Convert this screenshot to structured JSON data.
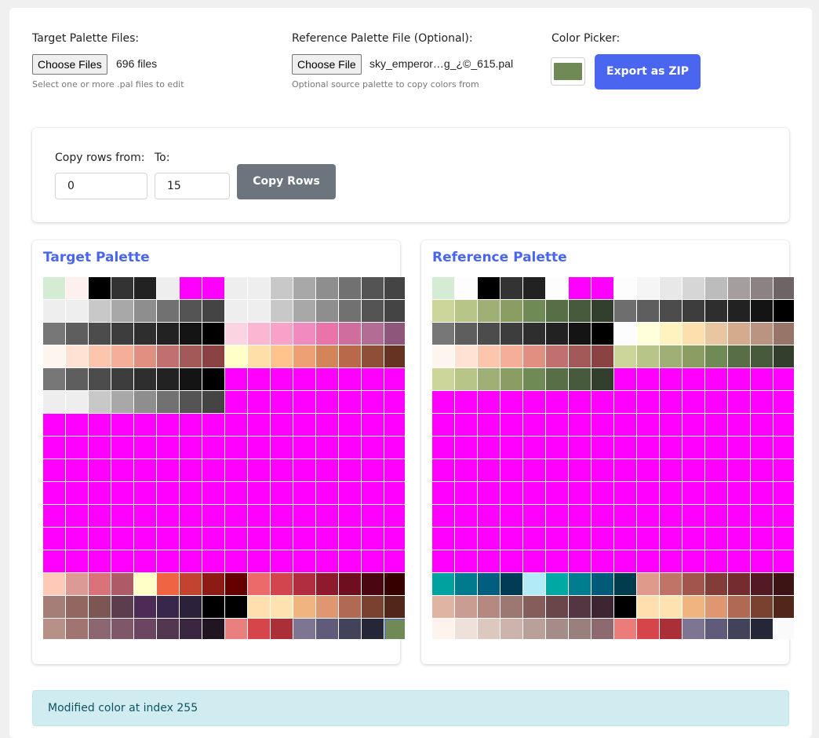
{
  "target_files": {
    "label": "Target Palette Files:",
    "button": "Choose Files",
    "file_status": "696 files",
    "help": "Select one or more .pal files to edit"
  },
  "reference_file": {
    "label": "Reference Palette File (Optional):",
    "button": "Choose File",
    "file_status": "sky_emperor…g_¿©_615.pal",
    "help": "Optional source palette to copy colors from"
  },
  "color_picker": {
    "label": "Color Picker:",
    "color": "#6f8a55"
  },
  "export_button": "Export as ZIP",
  "copy_rows": {
    "from_label": "Copy rows from:",
    "to_label": "To:",
    "from_value": "0",
    "to_value": "15",
    "button": "Copy Rows"
  },
  "target_palette": {
    "title": "Target Palette",
    "selected_index": 255,
    "rows": [
      [
        "#d4ecd3",
        "#fff0f0",
        "#000000",
        "#333333",
        "#222222",
        "#eeeeee",
        "#ff00ff",
        "#ff00ff",
        "#eeeeee",
        "#eeeeee",
        "#c8c8c8",
        "#a8a8a8",
        "#8e8e8e",
        "#717171",
        "#545454",
        "#444444"
      ],
      [
        "#eeeeee",
        "#eeeeee",
        "#c8c8c8",
        "#a8a8a8",
        "#8e8e8e",
        "#717171",
        "#545454",
        "#444444",
        "#eeeeee",
        "#eeeeee",
        "#c8c8c8",
        "#a8a8a8",
        "#8e8e8e",
        "#717171",
        "#545454",
        "#444444"
      ],
      [
        "#777777",
        "#5e5e5e",
        "#4c4c4c",
        "#3d3d3d",
        "#2e2e2e",
        "#222222",
        "#141414",
        "#000000",
        "#fcd3e1",
        "#fbb7d2",
        "#f8a2c8",
        "#f18bbf",
        "#ea73aa",
        "#d06d9f",
        "#b36c94",
        "#8e567a"
      ],
      [
        "#fff5ef",
        "#ffe2d4",
        "#fdc5ae",
        "#f5ae98",
        "#e18f81",
        "#c17070",
        "#a45959",
        "#8a4242",
        "#ffffc8",
        "#ffdfa8",
        "#ffc48d",
        "#eda073",
        "#d48459",
        "#b8694a",
        "#8f4e36",
        "#663222"
      ],
      [
        "#777777",
        "#5e5e5e",
        "#4c4c4c",
        "#3d3d3d",
        "#2e2e2e",
        "#222222",
        "#141414",
        "#000000",
        "#ff00ff",
        "#ff00ff",
        "#ff00ff",
        "#ff00ff",
        "#ff00ff",
        "#ff00ff",
        "#ff00ff",
        "#ff00ff"
      ],
      [
        "#eeeeee",
        "#eeeeee",
        "#c8c8c8",
        "#a8a8a8",
        "#8e8e8e",
        "#717171",
        "#545454",
        "#444444",
        "#ff00ff",
        "#ff00ff",
        "#ff00ff",
        "#ff00ff",
        "#ff00ff",
        "#ff00ff",
        "#ff00ff",
        "#ff00ff"
      ],
      [
        "#ff00ff",
        "#ff00ff",
        "#ff00ff",
        "#ff00ff",
        "#ff00ff",
        "#ff00ff",
        "#ff00ff",
        "#ff00ff",
        "#ff00ff",
        "#ff00ff",
        "#ff00ff",
        "#ff00ff",
        "#ff00ff",
        "#ff00ff",
        "#ff00ff",
        "#ff00ff"
      ],
      [
        "#ff00ff",
        "#ff00ff",
        "#ff00ff",
        "#ff00ff",
        "#ff00ff",
        "#ff00ff",
        "#ff00ff",
        "#ff00ff",
        "#ff00ff",
        "#ff00ff",
        "#ff00ff",
        "#ff00ff",
        "#ff00ff",
        "#ff00ff",
        "#ff00ff",
        "#ff00ff"
      ],
      [
        "#ff00ff",
        "#ff00ff",
        "#ff00ff",
        "#ff00ff",
        "#ff00ff",
        "#ff00ff",
        "#ff00ff",
        "#ff00ff",
        "#ff00ff",
        "#ff00ff",
        "#ff00ff",
        "#ff00ff",
        "#ff00ff",
        "#ff00ff",
        "#ff00ff",
        "#ff00ff"
      ],
      [
        "#ff00ff",
        "#ff00ff",
        "#ff00ff",
        "#ff00ff",
        "#ff00ff",
        "#ff00ff",
        "#ff00ff",
        "#ff00ff",
        "#ff00ff",
        "#ff00ff",
        "#ff00ff",
        "#ff00ff",
        "#ff00ff",
        "#ff00ff",
        "#ff00ff",
        "#ff00ff"
      ],
      [
        "#ff00ff",
        "#ff00ff",
        "#ff00ff",
        "#ff00ff",
        "#ff00ff",
        "#ff00ff",
        "#ff00ff",
        "#ff00ff",
        "#ff00ff",
        "#ff00ff",
        "#ff00ff",
        "#ff00ff",
        "#ff00ff",
        "#ff00ff",
        "#ff00ff",
        "#ff00ff"
      ],
      [
        "#ff00ff",
        "#ff00ff",
        "#ff00ff",
        "#ff00ff",
        "#ff00ff",
        "#ff00ff",
        "#ff00ff",
        "#ff00ff",
        "#ff00ff",
        "#ff00ff",
        "#ff00ff",
        "#ff00ff",
        "#ff00ff",
        "#ff00ff",
        "#ff00ff",
        "#ff00ff"
      ],
      [
        "#ff00ff",
        "#ff00ff",
        "#ff00ff",
        "#ff00ff",
        "#ff00ff",
        "#ff00ff",
        "#ff00ff",
        "#ff00ff",
        "#ff00ff",
        "#ff00ff",
        "#ff00ff",
        "#ff00ff",
        "#ff00ff",
        "#ff00ff",
        "#ff00ff",
        "#ff00ff"
      ],
      [
        "#fecab7",
        "#dc9a94",
        "#da727a",
        "#ae5b68",
        "#ffffc8",
        "#ef6442",
        "#c24330",
        "#8c1b15",
        "#660000",
        "#ed6a6a",
        "#d3454e",
        "#b12e40",
        "#8e1a2d",
        "#6e0e1f",
        "#4b0711",
        "#360000"
      ],
      [
        "#a57e77",
        "#91675f",
        "#7d5553",
        "#5c3d4e",
        "#4c2b56",
        "#38264b",
        "#2b213a",
        "#000000",
        "#000000",
        "#ffdfad",
        "#fee2b0",
        "#f0b481",
        "#df9772",
        "#b06952",
        "#7a4030",
        "#522719"
      ],
      [
        "#b79188",
        "#a07571",
        "#8c6671",
        "#7f5769",
        "#6b4562",
        "#533751",
        "#3a2640",
        "#201520",
        "#e88080",
        "#d5454a",
        "#ab2f37",
        "#7e7593",
        "#605b7a",
        "#43425b",
        "#262639",
        "#6f8a55"
      ]
    ]
  },
  "reference_palette": {
    "title": "Reference Palette",
    "rows": [
      [
        "#d4ecd3",
        "#fdfdfd",
        "#000000",
        "#333333",
        "#222222",
        "#fdfdfd",
        "#ff00ff",
        "#ff00ff",
        "#fdfdfd",
        "#f5f5f5",
        "#e8e8e8",
        "#d6d6d6",
        "#bcbcbc",
        "#a59d9e",
        "#8c8283",
        "#6e6466"
      ],
      [
        "#ccd69b",
        "#b7c589",
        "#9fb077",
        "#8a9e64",
        "#6f8a55",
        "#586e46",
        "#475a3b",
        "#323f2c",
        "#6e6e6e",
        "#5e5e5e",
        "#4c4c4c",
        "#3d3d3d",
        "#2e2e2e",
        "#222222",
        "#141414",
        "#000000"
      ],
      [
        "#777777",
        "#5e5e5e",
        "#4c4c4c",
        "#3d3d3d",
        "#2e2e2e",
        "#222222",
        "#141414",
        "#000000",
        "#fdfdfd",
        "#ffffdc",
        "#fff4c0",
        "#fddfae",
        "#e8c6a2",
        "#d4ab8c",
        "#bb9481",
        "#987569"
      ],
      [
        "#fff5ef",
        "#ffe2d4",
        "#fdc5ae",
        "#f5ae98",
        "#e18f81",
        "#c17070",
        "#a45959",
        "#8a4242",
        "#ccd69b",
        "#b7c589",
        "#9fb077",
        "#8a9e64",
        "#6f8a55",
        "#586e46",
        "#475a3b",
        "#323f2c"
      ],
      [
        "#ccd69b",
        "#b7c589",
        "#9fb077",
        "#8a9e64",
        "#6f8a55",
        "#586e46",
        "#475a3b",
        "#323f2c",
        "#ff00ff",
        "#ff00ff",
        "#ff00ff",
        "#ff00ff",
        "#ff00ff",
        "#ff00ff",
        "#ff00ff",
        "#ff00ff"
      ],
      [
        "#ff00ff",
        "#ff00ff",
        "#ff00ff",
        "#ff00ff",
        "#ff00ff",
        "#ff00ff",
        "#ff00ff",
        "#ff00ff",
        "#ff00ff",
        "#ff00ff",
        "#ff00ff",
        "#ff00ff",
        "#ff00ff",
        "#ff00ff",
        "#ff00ff",
        "#ff00ff"
      ],
      [
        "#ff00ff",
        "#ff00ff",
        "#ff00ff",
        "#ff00ff",
        "#ff00ff",
        "#ff00ff",
        "#ff00ff",
        "#ff00ff",
        "#ff00ff",
        "#ff00ff",
        "#ff00ff",
        "#ff00ff",
        "#ff00ff",
        "#ff00ff",
        "#ff00ff",
        "#ff00ff"
      ],
      [
        "#ff00ff",
        "#ff00ff",
        "#ff00ff",
        "#ff00ff",
        "#ff00ff",
        "#ff00ff",
        "#ff00ff",
        "#ff00ff",
        "#ff00ff",
        "#ff00ff",
        "#ff00ff",
        "#ff00ff",
        "#ff00ff",
        "#ff00ff",
        "#ff00ff",
        "#ff00ff"
      ],
      [
        "#ff00ff",
        "#ff00ff",
        "#ff00ff",
        "#ff00ff",
        "#ff00ff",
        "#ff00ff",
        "#ff00ff",
        "#ff00ff",
        "#ff00ff",
        "#ff00ff",
        "#ff00ff",
        "#ff00ff",
        "#ff00ff",
        "#ff00ff",
        "#ff00ff",
        "#ff00ff"
      ],
      [
        "#ff00ff",
        "#ff00ff",
        "#ff00ff",
        "#ff00ff",
        "#ff00ff",
        "#ff00ff",
        "#ff00ff",
        "#ff00ff",
        "#ff00ff",
        "#ff00ff",
        "#ff00ff",
        "#ff00ff",
        "#ff00ff",
        "#ff00ff",
        "#ff00ff",
        "#ff00ff"
      ],
      [
        "#ff00ff",
        "#ff00ff",
        "#ff00ff",
        "#ff00ff",
        "#ff00ff",
        "#ff00ff",
        "#ff00ff",
        "#ff00ff",
        "#ff00ff",
        "#ff00ff",
        "#ff00ff",
        "#ff00ff",
        "#ff00ff",
        "#ff00ff",
        "#ff00ff",
        "#ff00ff"
      ],
      [
        "#ff00ff",
        "#ff00ff",
        "#ff00ff",
        "#ff00ff",
        "#ff00ff",
        "#ff00ff",
        "#ff00ff",
        "#ff00ff",
        "#ff00ff",
        "#ff00ff",
        "#ff00ff",
        "#ff00ff",
        "#ff00ff",
        "#ff00ff",
        "#ff00ff",
        "#ff00ff"
      ],
      [
        "#ff00ff",
        "#ff00ff",
        "#ff00ff",
        "#ff00ff",
        "#ff00ff",
        "#ff00ff",
        "#ff00ff",
        "#ff00ff",
        "#ff00ff",
        "#ff00ff",
        "#ff00ff",
        "#ff00ff",
        "#ff00ff",
        "#ff00ff",
        "#ff00ff",
        "#ff00ff"
      ],
      [
        "#00a29f",
        "#007a8c",
        "#005f7e",
        "#003c55",
        "#b2ebf7",
        "#00a8a4",
        "#007d8f",
        "#005a78",
        "#003c4e",
        "#df9a8c",
        "#c07467",
        "#a1554d",
        "#833d38",
        "#742c2e",
        "#531a23",
        "#3c1414"
      ],
      [
        "#e0b4a3",
        "#c99d91",
        "#b5897f",
        "#9d7772",
        "#855e5c",
        "#6a4549",
        "#533641",
        "#3d2532",
        "#000000",
        "#ffdfad",
        "#fee2b0",
        "#f0b481",
        "#df9772",
        "#b06952",
        "#7a4030",
        "#522719"
      ],
      [
        "#fff3ee",
        "#f0e0da",
        "#ddc8c0",
        "#ccb4ac",
        "#b9a19a",
        "#a68c88",
        "#99807d",
        "#8c6a70",
        "#ea7c7a",
        "#d5454a",
        "#ab2f37",
        "#7e7593",
        "#605b7a",
        "#43425b",
        "#262639",
        "#fafafa"
      ]
    ]
  },
  "status_message": "Modified color at index 255"
}
